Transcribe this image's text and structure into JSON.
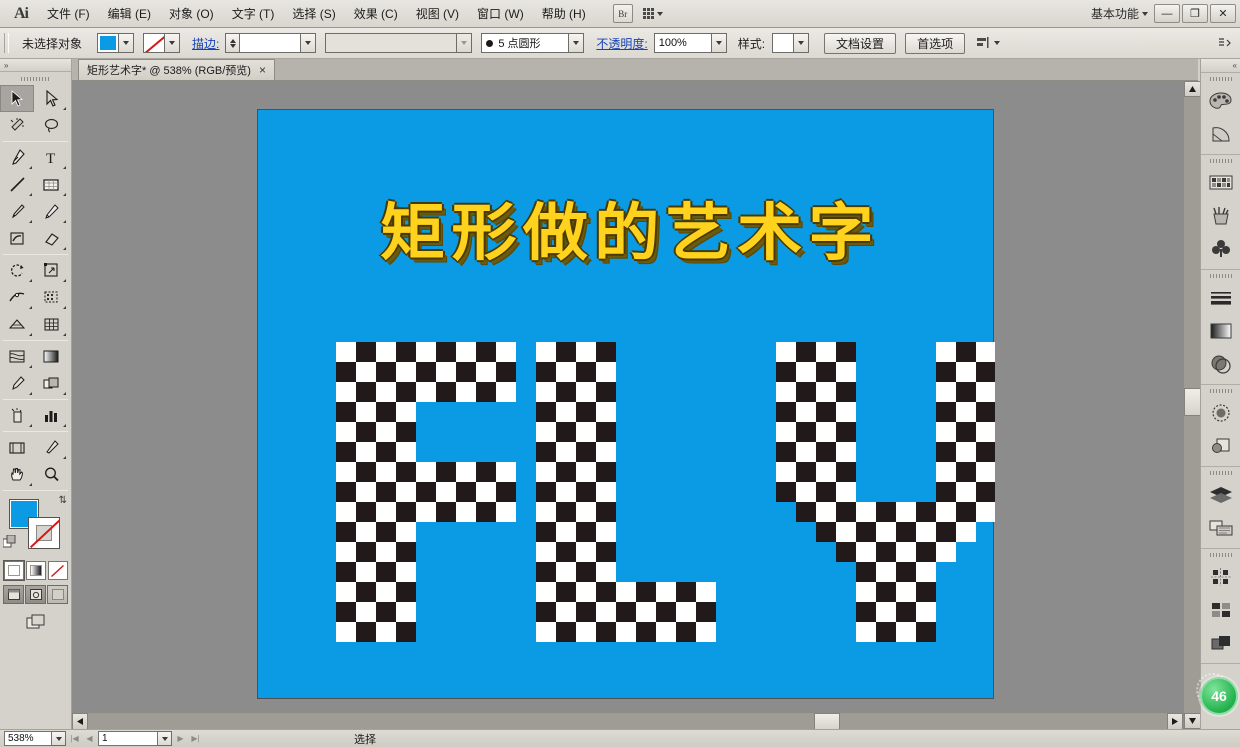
{
  "app": {
    "name": "Ai",
    "logo_text": "Ai"
  },
  "menubar": {
    "items": [
      {
        "label": "文件 (F)"
      },
      {
        "label": "编辑 (E)"
      },
      {
        "label": "对象 (O)"
      },
      {
        "label": "文字 (T)"
      },
      {
        "label": "选择 (S)"
      },
      {
        "label": "效果 (C)"
      },
      {
        "label": "视图 (V)"
      },
      {
        "label": "窗口 (W)"
      },
      {
        "label": "帮助 (H)"
      }
    ],
    "bridge_label": "Br",
    "arrange_icon": "grid-icon",
    "workspace": "基本功能",
    "window_controls": {
      "minimize": "—",
      "restore": "❐",
      "close": "✕"
    }
  },
  "controlbar": {
    "selection_label": "未选择对象",
    "fill_color": "#0b9ae4",
    "stroke_color": "none",
    "stroke_label": "描边:",
    "stroke_weight": "",
    "stroke_profile": "",
    "brush_definition": "5 点圆形",
    "opacity_label": "不透明度:",
    "opacity_value": "100%",
    "style_label": "样式:",
    "document_setup_label": "文档设置",
    "preferences_label": "首选项",
    "align_icon": "align-icon",
    "panel_menu_icon": "panel-menu-icon"
  },
  "tabbar": {
    "tab_title": "矩形艺术字* @ 538% (RGB/预览)",
    "close_label": "×"
  },
  "toolbar": {
    "tools": [
      {
        "name": "selection-tool",
        "active": true
      },
      {
        "name": "direct-selection-tool",
        "active": false
      },
      {
        "name": "magic-wand-tool",
        "active": false
      },
      {
        "name": "lasso-tool",
        "active": false
      },
      {
        "name": "pen-tool",
        "active": false
      },
      {
        "name": "type-tool",
        "active": false
      },
      {
        "name": "line-segment-tool",
        "active": false
      },
      {
        "name": "rectangle-tool",
        "active": false
      },
      {
        "name": "paintbrush-tool",
        "active": false
      },
      {
        "name": "pencil-tool",
        "active": false
      },
      {
        "name": "blob-brush-tool",
        "active": false
      },
      {
        "name": "eraser-tool",
        "active": false
      },
      {
        "name": "rotate-tool",
        "active": false
      },
      {
        "name": "scale-tool",
        "active": false
      },
      {
        "name": "width-tool",
        "active": false
      },
      {
        "name": "shape-builder-tool",
        "active": false
      },
      {
        "name": "perspective-grid-tool",
        "active": false
      },
      {
        "name": "graph-tool",
        "active": false
      },
      {
        "name": "mesh-tool",
        "active": false
      },
      {
        "name": "gradient-tool",
        "active": false
      },
      {
        "name": "eyedropper-tool",
        "active": false
      },
      {
        "name": "blend-tool",
        "active": false
      },
      {
        "name": "symbol-sprayer-tool",
        "active": false
      },
      {
        "name": "column-graph-tool",
        "active": false
      },
      {
        "name": "artboard-tool",
        "active": false
      },
      {
        "name": "slice-tool",
        "active": false
      },
      {
        "name": "hand-tool",
        "active": false
      },
      {
        "name": "zoom-tool",
        "active": false
      }
    ],
    "fill_color": "#0b9ae4",
    "stroke_color": "none",
    "paint_modes": [
      "color-mode",
      "gradient-mode",
      "none-mode"
    ],
    "screen_modes": [
      "normal-screen-mode",
      "full-screen-menubar-mode",
      "full-screen-mode"
    ]
  },
  "right_dock": {
    "panels": [
      {
        "name": "color-panel-icon"
      },
      {
        "name": "color-guide-panel-icon"
      },
      {
        "name": "swatches-panel-icon"
      },
      {
        "name": "brushes-panel-icon"
      },
      {
        "name": "symbols-panel-icon"
      },
      {
        "name": "stroke-panel-icon"
      },
      {
        "name": "gradient-panel-icon"
      },
      {
        "name": "transparency-panel-icon"
      },
      {
        "name": "appearance-panel-icon"
      },
      {
        "name": "graphic-styles-panel-icon"
      },
      {
        "name": "layers-panel-icon"
      },
      {
        "name": "artboards-panel-icon"
      },
      {
        "name": "align-panel-icon"
      },
      {
        "name": "pathfinder-panel-icon"
      },
      {
        "name": "transform-panel-icon"
      }
    ],
    "expand_icon": "double-chevron-icon"
  },
  "artwork": {
    "background_color": "#0b9ae4",
    "title_text": "矩形做的艺术字",
    "title_color": "#ffd21e",
    "title_outline_color": "#4a3a00",
    "word": "FLY",
    "checker_dark": "#221a1a",
    "checker_light": "#ffffff",
    "cell_size": 20
  },
  "statusbar": {
    "zoom_value": "538%",
    "page_value": "1",
    "status_text": "选择",
    "first_icon": "first-page-icon",
    "prev_icon": "prev-page-icon",
    "next_icon": "next-page-icon",
    "last_icon": "last-page-icon"
  },
  "badge": {
    "value": "46"
  }
}
